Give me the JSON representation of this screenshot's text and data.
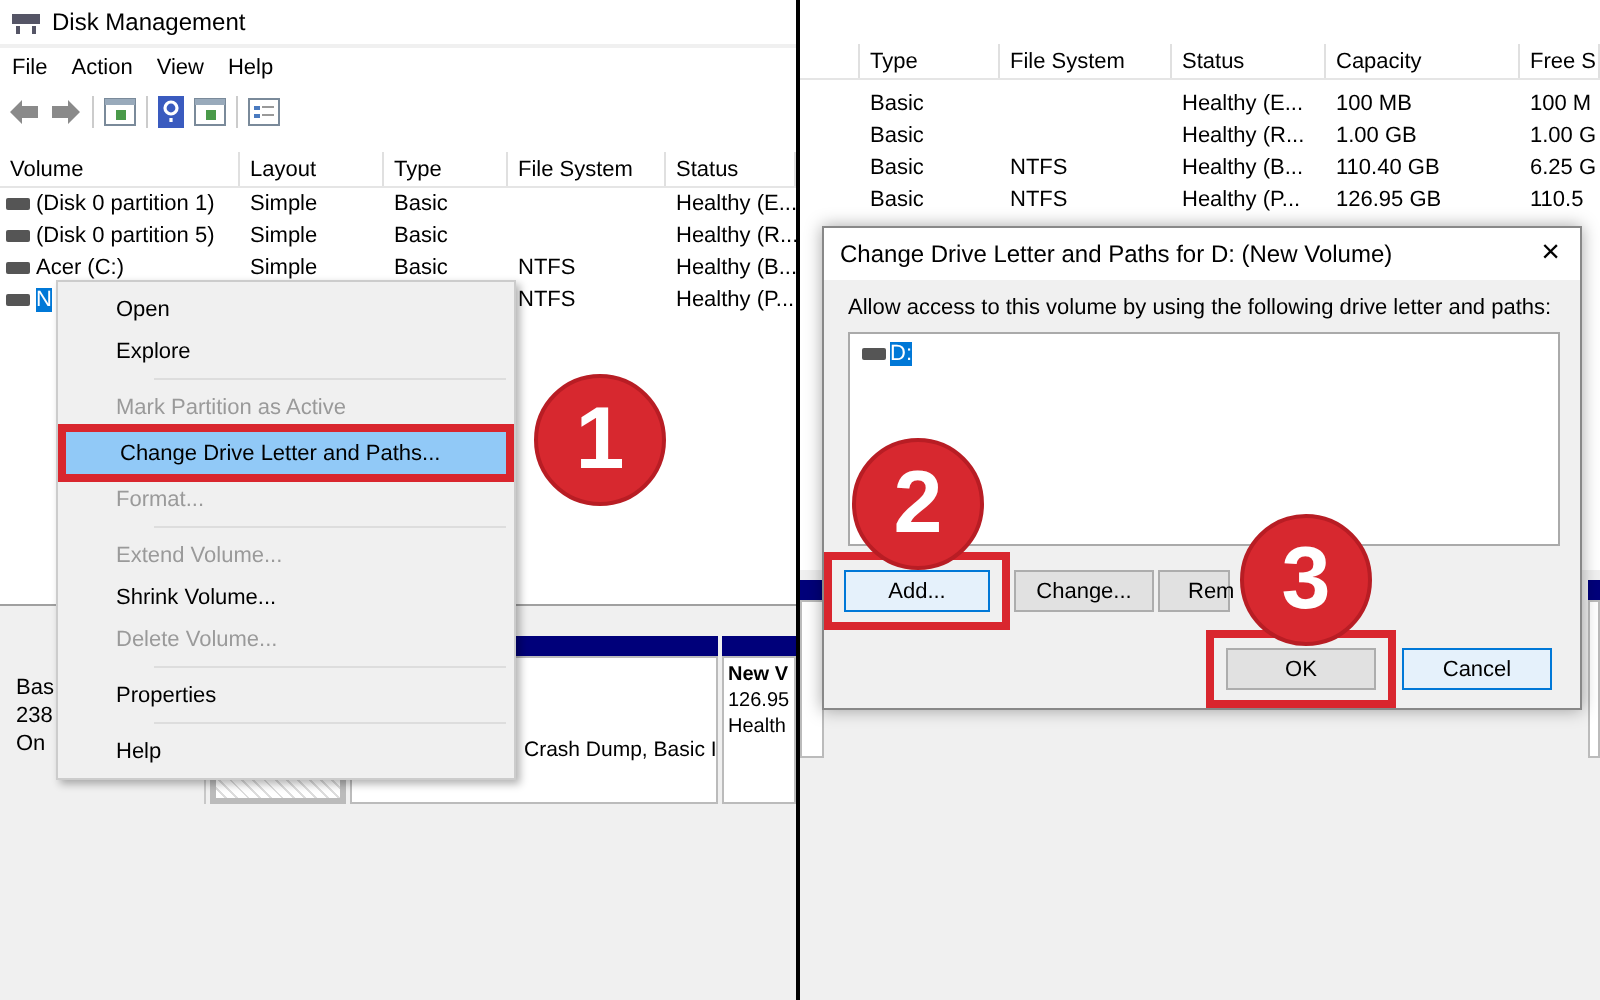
{
  "left_window": {
    "title": "Disk Management",
    "menu": [
      {
        "label": "File"
      },
      {
        "label": "Action"
      },
      {
        "label": "View"
      },
      {
        "label": "Help"
      }
    ],
    "table": {
      "columns": [
        "Volume",
        "Layout",
        "Type",
        "File System",
        "Status"
      ],
      "rows": [
        {
          "volume": "(Disk 0 partition 1)",
          "layout": "Simple",
          "type": "Basic",
          "status": "Healthy (E...",
          "selected": false
        },
        {
          "volume": "(Disk 0 partition 5)",
          "layout": "Simple",
          "type": "Basic",
          "status": "Healthy (R...",
          "selected": false
        },
        {
          "volume": "Acer (C:)",
          "layout": "Simple",
          "type": "Basic",
          "file_system": "NTFS",
          "status": "Healthy (B...",
          "selected": false
        },
        {
          "volume": "N",
          "file_system": "NTFS",
          "status": "Healthy (P...",
          "selected": true
        }
      ]
    },
    "context_menu": [
      [
        {
          "label": "Open",
          "disabled": false,
          "highlighted": false
        },
        {
          "label": "Explore",
          "disabled": false,
          "highlighted": false
        }
      ],
      [
        {
          "label": "Mark Partition as Active",
          "disabled": true,
          "highlighted": false
        },
        {
          "label": "Change Drive Letter and Paths...",
          "disabled": false,
          "highlighted": true,
          "framed": true
        },
        {
          "label": "Format...",
          "disabled": true,
          "highlighted": false
        }
      ],
      [
        {
          "label": "Extend Volume...",
          "disabled": true,
          "highlighted": false
        },
        {
          "label": "Shrink Volume...",
          "disabled": false,
          "highlighted": false
        },
        {
          "label": "Delete Volume...",
          "disabled": true,
          "highlighted": false
        }
      ],
      [
        {
          "label": "Properties",
          "disabled": false,
          "highlighted": false
        }
      ],
      [
        {
          "label": "Help",
          "disabled": false,
          "highlighted": false
        }
      ]
    ],
    "disk_map": {
      "disk_label": [
        "Bas",
        "238",
        "On"
      ],
      "partitions": [
        {
          "kind": "unallocated"
        },
        {
          "kind": "primary",
          "lines": [
            "Crash Dump, Basic I"
          ]
        },
        {
          "kind": "primary",
          "name": "New V",
          "lines": [
            "126.95",
            "Health"
          ]
        }
      ]
    }
  },
  "right_window": {
    "table": {
      "columns": [
        "Type",
        "File System",
        "Status",
        "Capacity",
        "Free S"
      ],
      "rows": [
        {
          "type": "Basic",
          "status": "Healthy (E...",
          "capacity": "100 MB",
          "free": "100 M"
        },
        {
          "type": "Basic",
          "status": "Healthy (R...",
          "capacity": "1.00 GB",
          "free": "1.00 G"
        },
        {
          "type": "Basic",
          "file_system": "NTFS",
          "status": "Healthy (B...",
          "capacity": "110.40 GB",
          "free": "6.25 G"
        },
        {
          "type": "Basic",
          "file_system": "NTFS",
          "status": "Healthy (P...",
          "capacity": "126.95 GB",
          "free": "110.5"
        }
      ]
    },
    "dialog": {
      "title": "Change Drive Letter and Paths for D: (New Volume)",
      "close": "×",
      "instruction": "Allow access to this volume by using the following drive letter and paths:",
      "list": [
        {
          "label": "D:",
          "selected": true
        }
      ],
      "buttons": [
        {
          "label": "Add...",
          "framed": true,
          "focused": true
        },
        {
          "label": "Change...",
          "framed": false,
          "focused": false
        },
        {
          "label": "Rem",
          "framed": false,
          "focused": false
        }
      ],
      "footer_buttons": [
        {
          "label": "OK",
          "framed": true,
          "focused": false
        },
        {
          "label": "Cancel",
          "framed": false,
          "focused": true
        }
      ]
    }
  },
  "steps": [
    {
      "number": "1"
    },
    {
      "number": "2"
    },
    {
      "number": "3"
    }
  ]
}
